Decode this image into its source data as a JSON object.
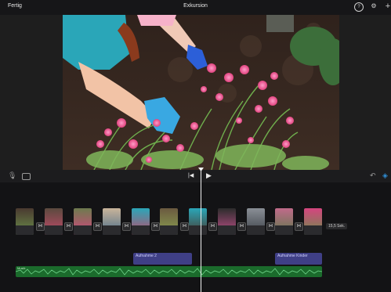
{
  "header": {
    "done_label": "Fertig",
    "title": "Exkursion"
  },
  "toolbar": {
    "skip_back_symbol": "|◀",
    "play_symbol": "▶"
  },
  "timeline": {
    "duration_badge": "15,5 Sek.",
    "transition_symbol": "⋈",
    "audio_clips": [
      {
        "label": "Aufnahme 2"
      },
      {
        "label": "Aufnahme Kinder"
      }
    ],
    "music_label": "Musik"
  },
  "colors": {
    "accent": "#2f8fd8",
    "music_track": "#1b6b2c",
    "audio_clip": "#3f3f86"
  }
}
